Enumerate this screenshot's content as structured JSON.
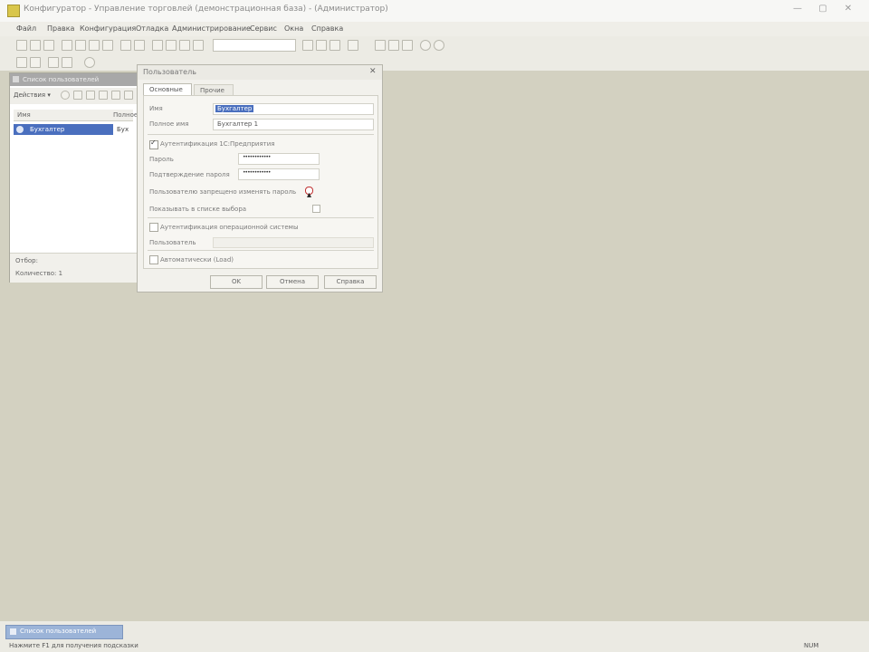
{
  "window": {
    "title": "Конфигуратор - Управление торговлей (демонстрационная база) - (Администратор)",
    "min": "—",
    "max": "▢",
    "close": "✕"
  },
  "menu": [
    "Файл",
    "Правка",
    "Конфигурация",
    "Отладка",
    "Администрирование",
    "Сервис",
    "Окна",
    "Справка"
  ],
  "panel": {
    "title": "Список пользователей",
    "toolbar_action": "Действия ▾",
    "col_name": "Имя",
    "col_full": "Полное",
    "row_name": "Бухгалтер",
    "row_trail": "Бух",
    "footer_a": "Отбор:",
    "footer_b": "Количество: 1"
  },
  "dialog": {
    "title": "Пользователь",
    "close": "✕",
    "tabs": [
      "Основные",
      "Прочие"
    ],
    "name_label": "Имя",
    "name_value": "Бухгалтер",
    "fullname_label": "Полное имя",
    "fullname_value": "Бухгалтер 1",
    "auth_1c": "Аутентификация 1С:Предприятия",
    "password_label": "Пароль",
    "password_value": "••••••••••••",
    "confirm_label": "Подтверждение пароля",
    "confirm_value": "••••••••••••",
    "cannot_change": "Пользователю запрещено изменять пароль",
    "show_in_list": "Показывать в списке выбора",
    "auth_os": "Аутентификация операционной системы",
    "os_user_label": "Пользователь",
    "autocheck": "Автоматически (Load)",
    "ok": "OK",
    "cancel": "Отмена",
    "help": "Справка"
  },
  "status": {
    "task_label": "Список пользователей",
    "left": "Нажмите F1 для получения подсказки",
    "right": "NUM"
  },
  "colors": {
    "workspace": "#d3d1c1",
    "selection": "#4a6fbe",
    "accent_red": "#cc2222"
  }
}
